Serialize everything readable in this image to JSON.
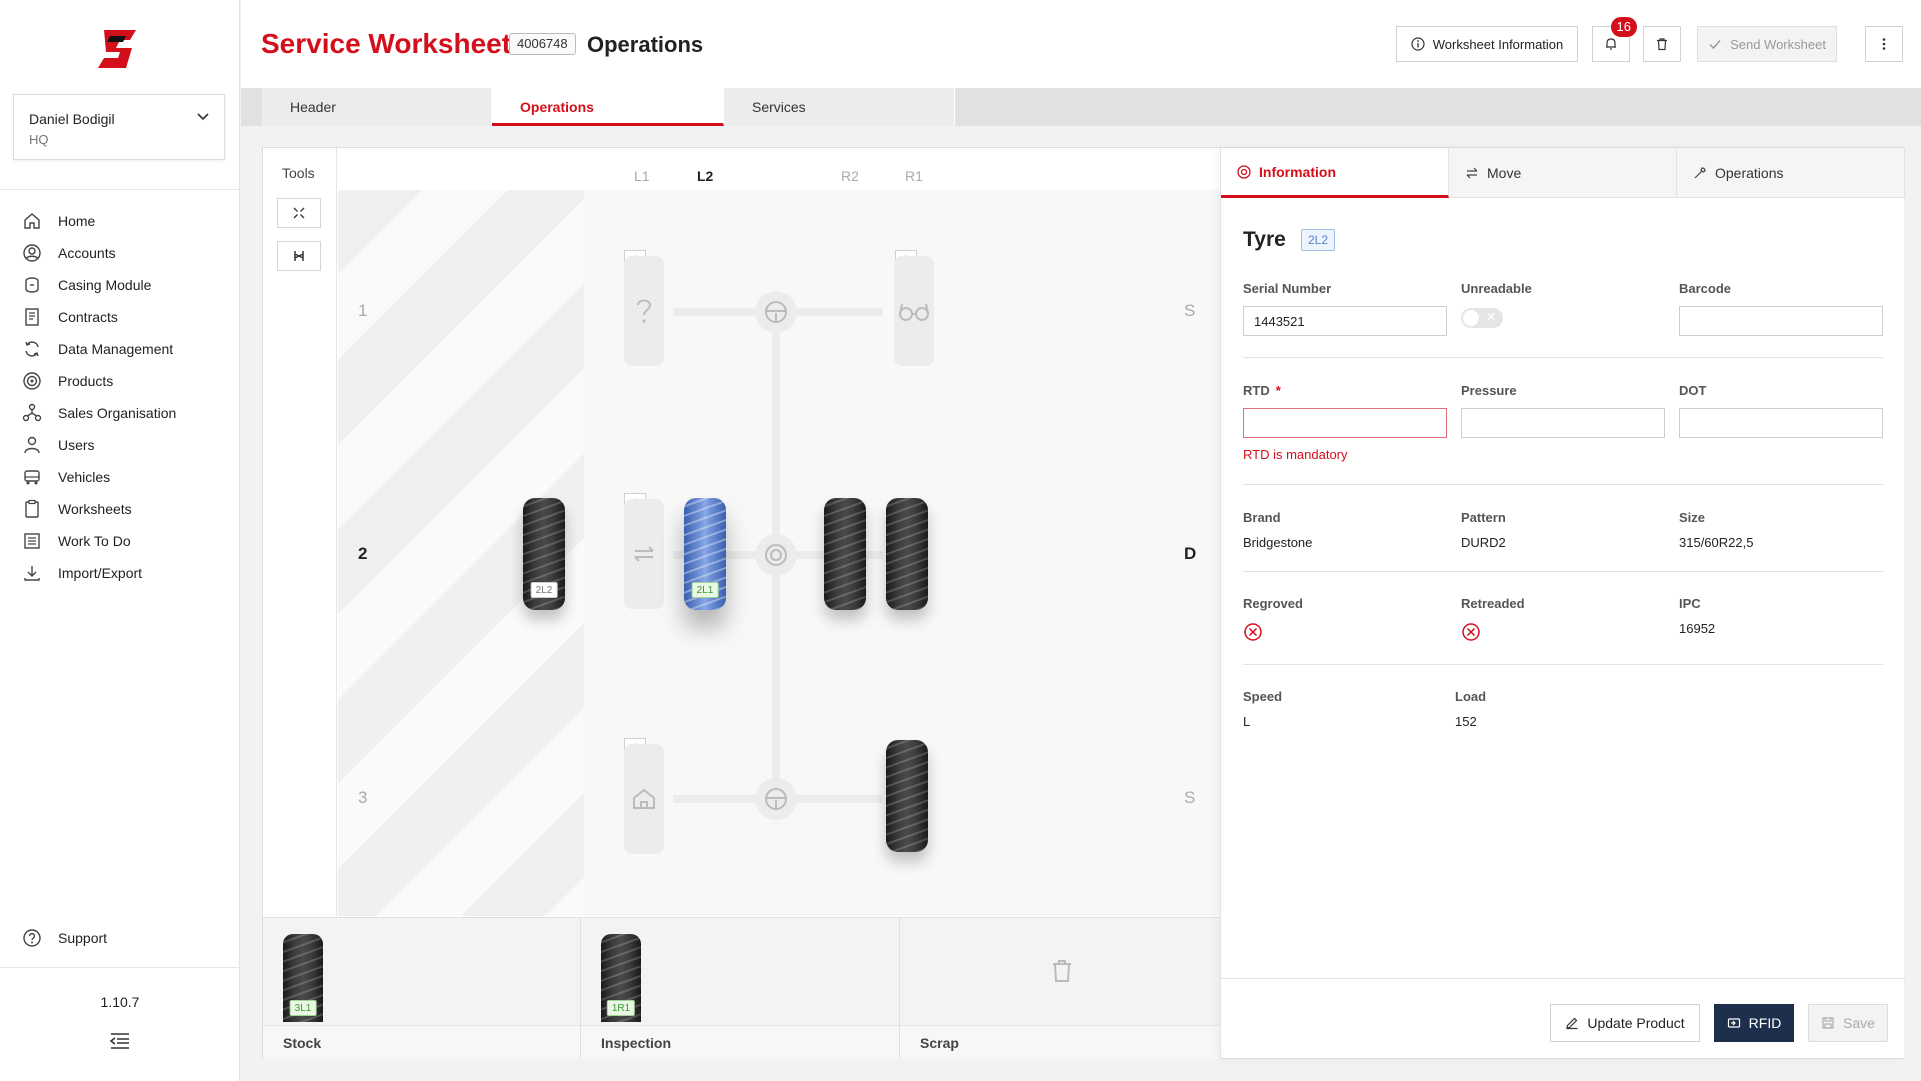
{
  "sidebar": {
    "user": {
      "name": "Daniel Bodigil",
      "org": "HQ"
    },
    "items": [
      {
        "label": "Home",
        "icon": "home-icon"
      },
      {
        "label": "Accounts",
        "icon": "account-icon"
      },
      {
        "label": "Casing Module",
        "icon": "casing-icon"
      },
      {
        "label": "Contracts",
        "icon": "contract-icon"
      },
      {
        "label": "Data Management",
        "icon": "sync-icon"
      },
      {
        "label": "Products",
        "icon": "tyre-icon"
      },
      {
        "label": "Sales Organisation",
        "icon": "org-icon"
      },
      {
        "label": "Users",
        "icon": "user-icon"
      },
      {
        "label": "Vehicles",
        "icon": "truck-icon"
      },
      {
        "label": "Worksheets",
        "icon": "clipboard-icon"
      },
      {
        "label": "Work To Do",
        "icon": "list-icon"
      },
      {
        "label": "Import/Export",
        "icon": "download-icon"
      }
    ],
    "support_label": "Support",
    "version": "1.10.7"
  },
  "header": {
    "title": "Service Worksheet",
    "worksheet_number": "4006748",
    "subtitle": "Operations",
    "worksheet_info_label": "Worksheet Information",
    "notifications_count": "16",
    "send_label": "Send Worksheet"
  },
  "tabs": [
    {
      "label": "Header"
    },
    {
      "label": "Operations",
      "active": true
    },
    {
      "label": "Services"
    }
  ],
  "tools": {
    "label": "Tools"
  },
  "vehicle": {
    "positions": [
      "L1",
      "L2",
      "R2",
      "R1"
    ],
    "active_position": "L2",
    "axles": [
      {
        "number": "1",
        "side": "S"
      },
      {
        "number": "2",
        "side": "D",
        "active": true
      },
      {
        "number": "3",
        "side": "S"
      }
    ],
    "tyre_tags": {
      "dragged": "2L2",
      "selected": "2L1"
    }
  },
  "bins": [
    {
      "label": "Stock",
      "tyre_tag": "3L1"
    },
    {
      "label": "Inspection",
      "tyre_tag": "1R1"
    },
    {
      "label": "Scrap"
    }
  ],
  "info_panel": {
    "tabs": [
      {
        "label": "Information",
        "active": true
      },
      {
        "label": "Move"
      },
      {
        "label": "Operations"
      }
    ],
    "title": "Tyre",
    "position_badge": "2L2",
    "fields": {
      "serial_number": {
        "label": "Serial Number",
        "value": "1443521"
      },
      "unreadable": {
        "label": "Unreadable",
        "on": false
      },
      "barcode": {
        "label": "Barcode",
        "value": ""
      },
      "rtd": {
        "label": "RTD",
        "required_mark": "*",
        "value": "",
        "error": "RTD is mandatory"
      },
      "pressure": {
        "label": "Pressure",
        "value": ""
      },
      "dot": {
        "label": "DOT",
        "value": ""
      },
      "brand": {
        "label": "Brand",
        "value": "Bridgestone"
      },
      "pattern": {
        "label": "Pattern",
        "value": "DURD2"
      },
      "size": {
        "label": "Size",
        "value": "315/60R22,5"
      },
      "regroved": {
        "label": "Regroved"
      },
      "retreaded": {
        "label": "Retreaded"
      },
      "ipc": {
        "label": "IPC",
        "value": "16952"
      },
      "speed": {
        "label": "Speed",
        "value": "L"
      },
      "load": {
        "label": "Load",
        "value": "152"
      }
    },
    "buttons": {
      "update_product": "Update Product",
      "rfid": "RFID",
      "save": "Save"
    }
  },
  "colors": {
    "brand_red": "#d40f1c",
    "navy": "#1e2f4e",
    "selected_tyre_blue": "#6d8fd6"
  }
}
